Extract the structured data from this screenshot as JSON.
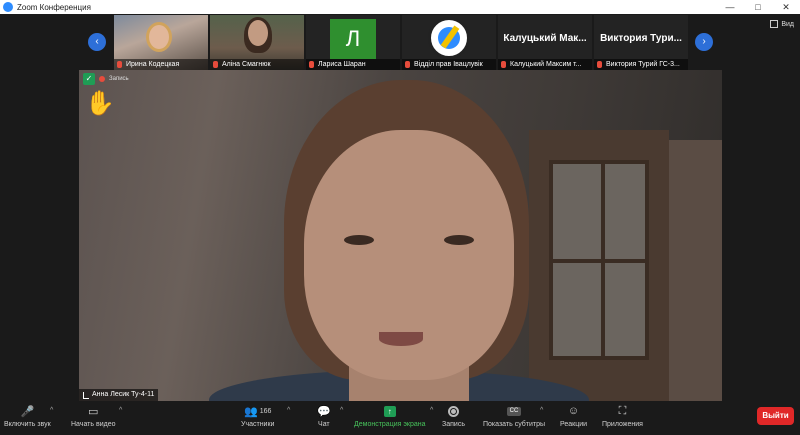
{
  "window": {
    "title": "Zoom Конференция",
    "minimize": "—",
    "maximize": "□",
    "close": "✕"
  },
  "view_button": {
    "label": "Вид"
  },
  "participants_strip": [
    {
      "name": "Ирина Кодецкая"
    },
    {
      "name": "Аліна Смагнюк"
    },
    {
      "name": "Лариса Шаран",
      "initial": "Л"
    },
    {
      "name": "Відділ прав Івацлувік"
    },
    {
      "name": "Калуцький Максим т...",
      "display": "Калуцький Мак..."
    },
    {
      "name": "Виктория Турий ГС-3...",
      "display": "Виктория Тури..."
    }
  ],
  "nav": {
    "prev": "‹",
    "next": "›"
  },
  "main_video": {
    "recording_label": "Запись",
    "speaker_name": "Анна Лесик Ту-4-11",
    "hand_icon": "✋"
  },
  "toolbar": {
    "mute": {
      "label": "Включить звук",
      "icon": "🎤"
    },
    "video": {
      "label": "Начать видео",
      "icon": "▭"
    },
    "participants": {
      "label": "Участники",
      "count": "166",
      "icon": "👥"
    },
    "chat": {
      "label": "Чат",
      "icon": "💬"
    },
    "share": {
      "label": "Демонстрация экрана",
      "icon": "↑"
    },
    "record": {
      "label": "Запись"
    },
    "captions": {
      "label": "Показать субтитры",
      "icon": "CC"
    },
    "reactions": {
      "label": "Реакции",
      "icon": "☺"
    },
    "apps": {
      "label": "Приложения",
      "icon": "⛶"
    },
    "caret": "^",
    "leave": {
      "label": "Выйти"
    }
  },
  "colors": {
    "accent": "#2d8cff",
    "leave": "#e02828",
    "share": "#47c25b",
    "background": "#1a1a1a"
  }
}
